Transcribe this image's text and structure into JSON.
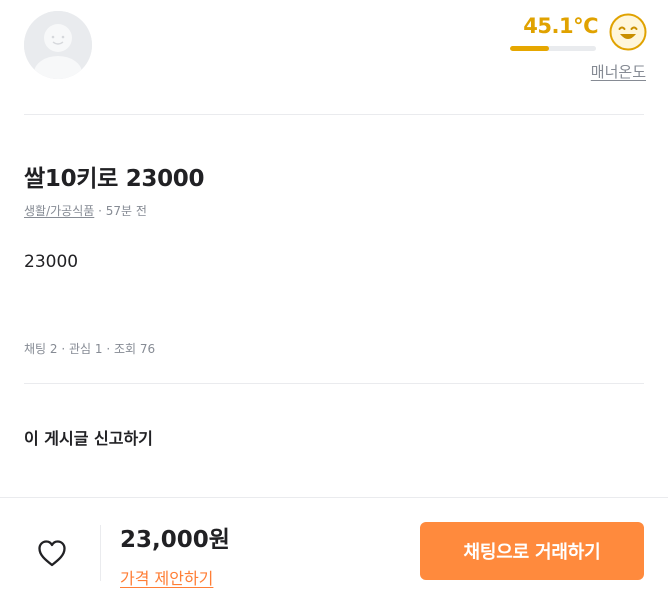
{
  "profile": {
    "avatar_icon": "default-user-avatar-icon"
  },
  "manner": {
    "temperature": "45.1℃",
    "temperature_fraction": 0.45,
    "label": "매너온도",
    "face_icon": "smiling-face-icon",
    "accent": "#e0a200"
  },
  "post": {
    "title": "쌀10키로 23000",
    "category": "생활/가공식품",
    "time_sep": " · ",
    "time": "57분 전",
    "body": "23000",
    "counts": "채팅 2 · 관심 1 · 조회 76",
    "report": "이 게시글 신고하기"
  },
  "bottom": {
    "heart_icon": "heart-outline-icon",
    "price": "23,000원",
    "offer": "가격 제안하기",
    "chat_button": "채팅으로 거래하기",
    "accent": "#ff8a3d"
  }
}
